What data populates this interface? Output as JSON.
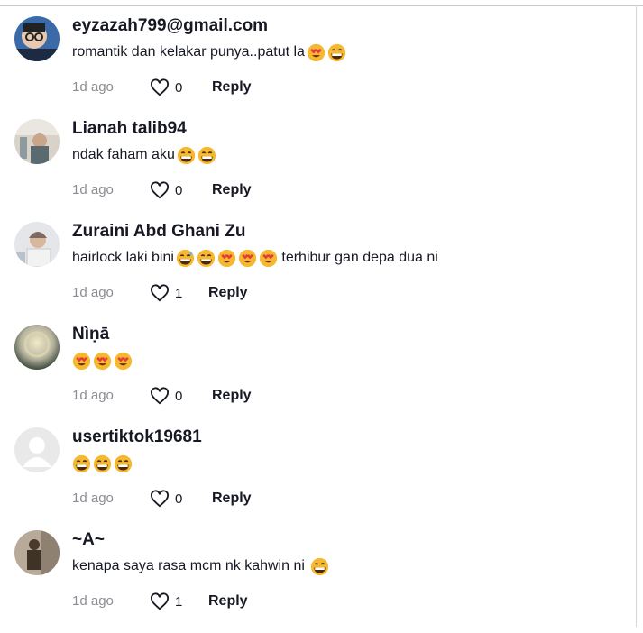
{
  "comments": [
    {
      "username": "eyzazah799@gmail.com",
      "text": "romantik dan kelakar punya..patut la",
      "emojis": [
        "heart-eyes-emoji",
        "grinning-emoji"
      ],
      "time": "1d ago",
      "likes": "0",
      "reply": "Reply",
      "avatar_icon": "avatar-photo-icon"
    },
    {
      "username": "Lianah talib94",
      "text": "ndak faham aku",
      "emojis": [
        "grinning-emoji",
        "grinning-emoji"
      ],
      "time": "1d ago",
      "likes": "0",
      "reply": "Reply",
      "avatar_icon": "avatar-photo-icon"
    },
    {
      "username": "Zuraini Abd Ghani Zu",
      "text": "hairlock laki bini",
      "emojis": [
        "sweat-smile-emoji",
        "grinning-emoji",
        "heart-eyes-emoji",
        "heart-eyes-emoji",
        "heart-eyes-emoji"
      ],
      "text_after": " terhibur gan depa dua ni",
      "time": "1d ago",
      "likes": "1",
      "reply": "Reply",
      "avatar_icon": "avatar-photo-icon"
    },
    {
      "username": "Nìṇā",
      "text": "",
      "emojis": [
        "heart-eyes-emoji",
        "heart-eyes-emoji",
        "heart-eyes-emoji"
      ],
      "time": "1d ago",
      "likes": "0",
      "reply": "Reply",
      "avatar_icon": "avatar-photo-icon"
    },
    {
      "username": "usertiktok19681",
      "text": "",
      "emojis": [
        "grinning-emoji",
        "grinning-emoji",
        "grinning-emoji"
      ],
      "time": "1d ago",
      "likes": "0",
      "reply": "Reply",
      "avatar_icon": "default-avatar-icon"
    },
    {
      "username": "~A~",
      "text": "kenapa saya rasa mcm nk kahwin ni ",
      "emojis": [
        "grinning-emoji"
      ],
      "time": "1d ago",
      "likes": "1",
      "reply": "Reply",
      "avatar_icon": "avatar-photo-icon"
    }
  ],
  "icons": {
    "like": "heart-outline-icon"
  },
  "colors": {
    "text": "#161823",
    "muted": "#8a8b91",
    "emoji_face": "#f5b82e"
  }
}
